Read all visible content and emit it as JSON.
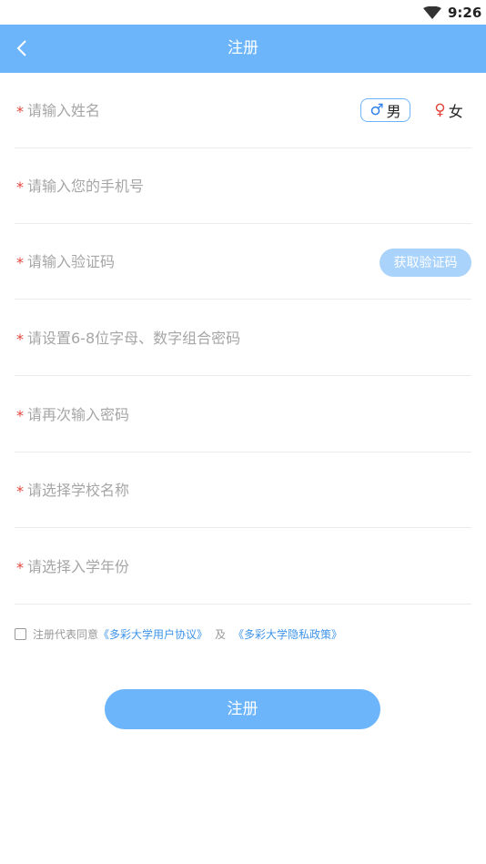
{
  "status_bar": {
    "time": "9:26",
    "icon": "wifi-icon"
  },
  "header": {
    "title": "注册",
    "back_icon": "back-arrow-icon"
  },
  "required_mark": "*",
  "fields": {
    "name": {
      "placeholder": "请输入姓名"
    },
    "phone": {
      "placeholder": "请输入您的手机号"
    },
    "code": {
      "placeholder": "请输入验证码",
      "button_label": "获取验证码"
    },
    "password": {
      "placeholder": "请设置6-8位字母、数字组合密码"
    },
    "confirm_password": {
      "placeholder": "请再次输入密码"
    },
    "school": {
      "placeholder": "请选择学校名称"
    },
    "year": {
      "placeholder": "请选择入学年份"
    }
  },
  "gender": {
    "male": {
      "symbol": "♂",
      "label": "男",
      "selected": true
    },
    "female": {
      "symbol": "♀",
      "label": "女",
      "selected": false
    }
  },
  "agreement": {
    "prefix": "注册代表同意",
    "user_agreement": "《多彩大学用户协议》",
    "and": "及",
    "privacy_policy": "《多彩大学隐私政策》",
    "checked": false
  },
  "submit": {
    "label": "注册"
  },
  "colors": {
    "primary": "#6cb5fb",
    "code_button": "#a9d3fb",
    "required": "#e2453b",
    "link": "#3f94e8"
  }
}
